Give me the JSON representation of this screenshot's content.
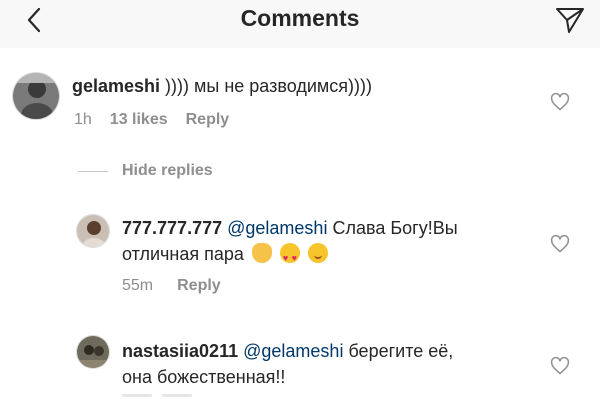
{
  "header": {
    "title": "Comments",
    "back_icon": "chevron-left-icon",
    "send_icon": "paper-plane-icon"
  },
  "comments": [
    {
      "username": "gelameshi",
      "text": " )))) мы не разводимся))))",
      "time": "1h",
      "likes": "13 likes",
      "reply": "Reply"
    }
  ],
  "hide_replies": "Hide replies",
  "replies": [
    {
      "username": "777.777.777",
      "mention": "@gelameshi",
      "text_line1": " Слава Богу!Вы",
      "text_line2": "отличная пара",
      "emojis": [
        "ok-hand-emoji",
        "heart-eyes-emoji",
        "hugging-face-emoji"
      ],
      "time": "55m",
      "reply": "Reply"
    },
    {
      "username": "nastasiia0211",
      "mention": "@gelameshi",
      "text_line1": " берегите её,",
      "text_line2": "она божественная!!"
    }
  ],
  "colors": {
    "text": "#262626",
    "secondary": "#8e8e8e",
    "mention": "#00376b",
    "header_bg": "#f8f8f8"
  }
}
